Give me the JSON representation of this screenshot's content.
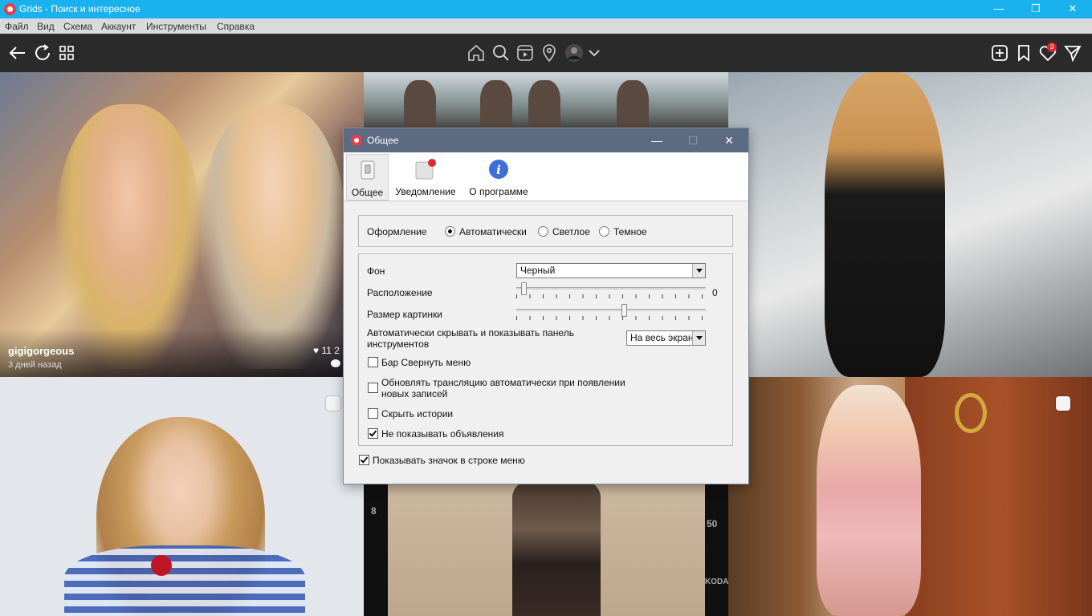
{
  "window": {
    "title": "Grids - Поиск и интересное",
    "minimize": "—",
    "maximize": "❐",
    "close": "✕"
  },
  "menu": [
    "Файл",
    "Вид",
    "Схема",
    "Аккаунт",
    "Инструменты",
    "Справка"
  ],
  "toolbar": {
    "left_icons": [
      "back-arrow-icon",
      "refresh-icon",
      "grid-icon"
    ],
    "center_icons": [
      "home-icon",
      "search-icon",
      "video-icon",
      "location-icon",
      "avatar",
      "chevron-down-icon"
    ],
    "right_icons": [
      "add-icon",
      "bookmark-icon",
      "heart-icon",
      "send-icon"
    ],
    "notification_count": "3"
  },
  "feed": {
    "post1": {
      "username": "gigigorgeous",
      "time": "3 дней назад",
      "likes": "11 2"
    },
    "film_label_left": "8",
    "film_label_right": "50",
    "film_brand": "KODAK"
  },
  "dialog": {
    "title": "Общее",
    "minimize": "—",
    "maximize": "☐",
    "close": "✕",
    "tabs": [
      {
        "label": "Общее",
        "icon": "switch-icon",
        "active": true
      },
      {
        "label": "Уведомление",
        "icon": "notification-icon",
        "active": false
      },
      {
        "label": "О программе",
        "icon": "info-icon",
        "active": false
      }
    ],
    "appearance": {
      "label": "Оформление",
      "options": [
        "Автоматически",
        "Светлое",
        "Темное"
      ],
      "selected": "Автоматически"
    },
    "background": {
      "label": "Фон",
      "value": "Черный"
    },
    "position": {
      "label": "Расположение",
      "value": "0",
      "level": 0.0
    },
    "image_size": {
      "label": "Размер картинки",
      "level": 0.57
    },
    "autohide": {
      "label": "Автоматически скрывать и показывать панель инструментов",
      "value": "На весь экран"
    },
    "checkboxes": [
      {
        "label": "Бар Свернуть меню",
        "checked": false
      },
      {
        "label": "Обновлять трансляцию автоматически при появлении новых записей",
        "checked": false
      },
      {
        "label": "Скрыть истории",
        "checked": false
      },
      {
        "label": "Не показывать объявления",
        "checked": true
      }
    ],
    "tray_icon": {
      "label": "Показывать значок в строке меню",
      "checked": true
    }
  },
  "colors": {
    "titlebar": "#1ab2ee",
    "toolbar": "#2b2b2b",
    "dialog_title": "#5c6a82",
    "badge": "#e0262e"
  }
}
